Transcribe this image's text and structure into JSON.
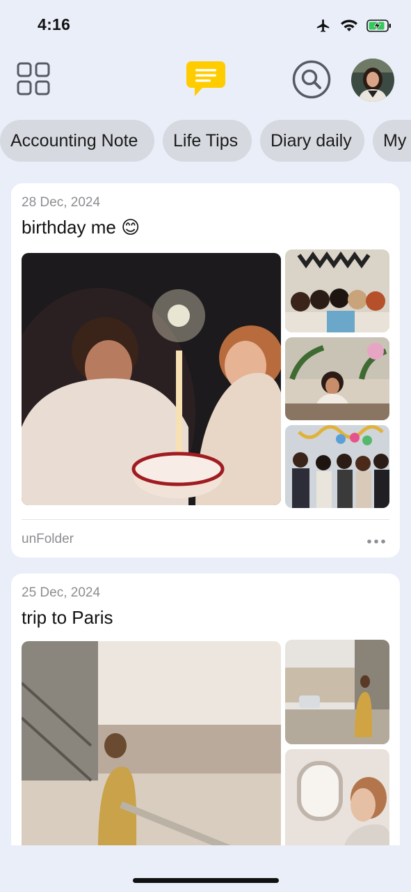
{
  "status_bar": {
    "time": "4:16"
  },
  "categories": [
    {
      "label": "Accounting Note"
    },
    {
      "label": "Life Tips"
    },
    {
      "label": "Diary daily"
    },
    {
      "label": "My"
    }
  ],
  "notes": [
    {
      "date": "28 Dec, 2024",
      "title": "birthday me 😊",
      "folder": "unFolder"
    },
    {
      "date": "25 Dec, 2024",
      "title": "trip to Paris"
    }
  ],
  "icons": {
    "grid": "grid-icon",
    "notes": "chat-notes-icon",
    "search": "search-icon",
    "more": "more-dots-icon"
  },
  "colors": {
    "background": "#e9eef8",
    "accent": "#ffcc00",
    "chip": "#d6d9df",
    "battery": "#34c759"
  }
}
